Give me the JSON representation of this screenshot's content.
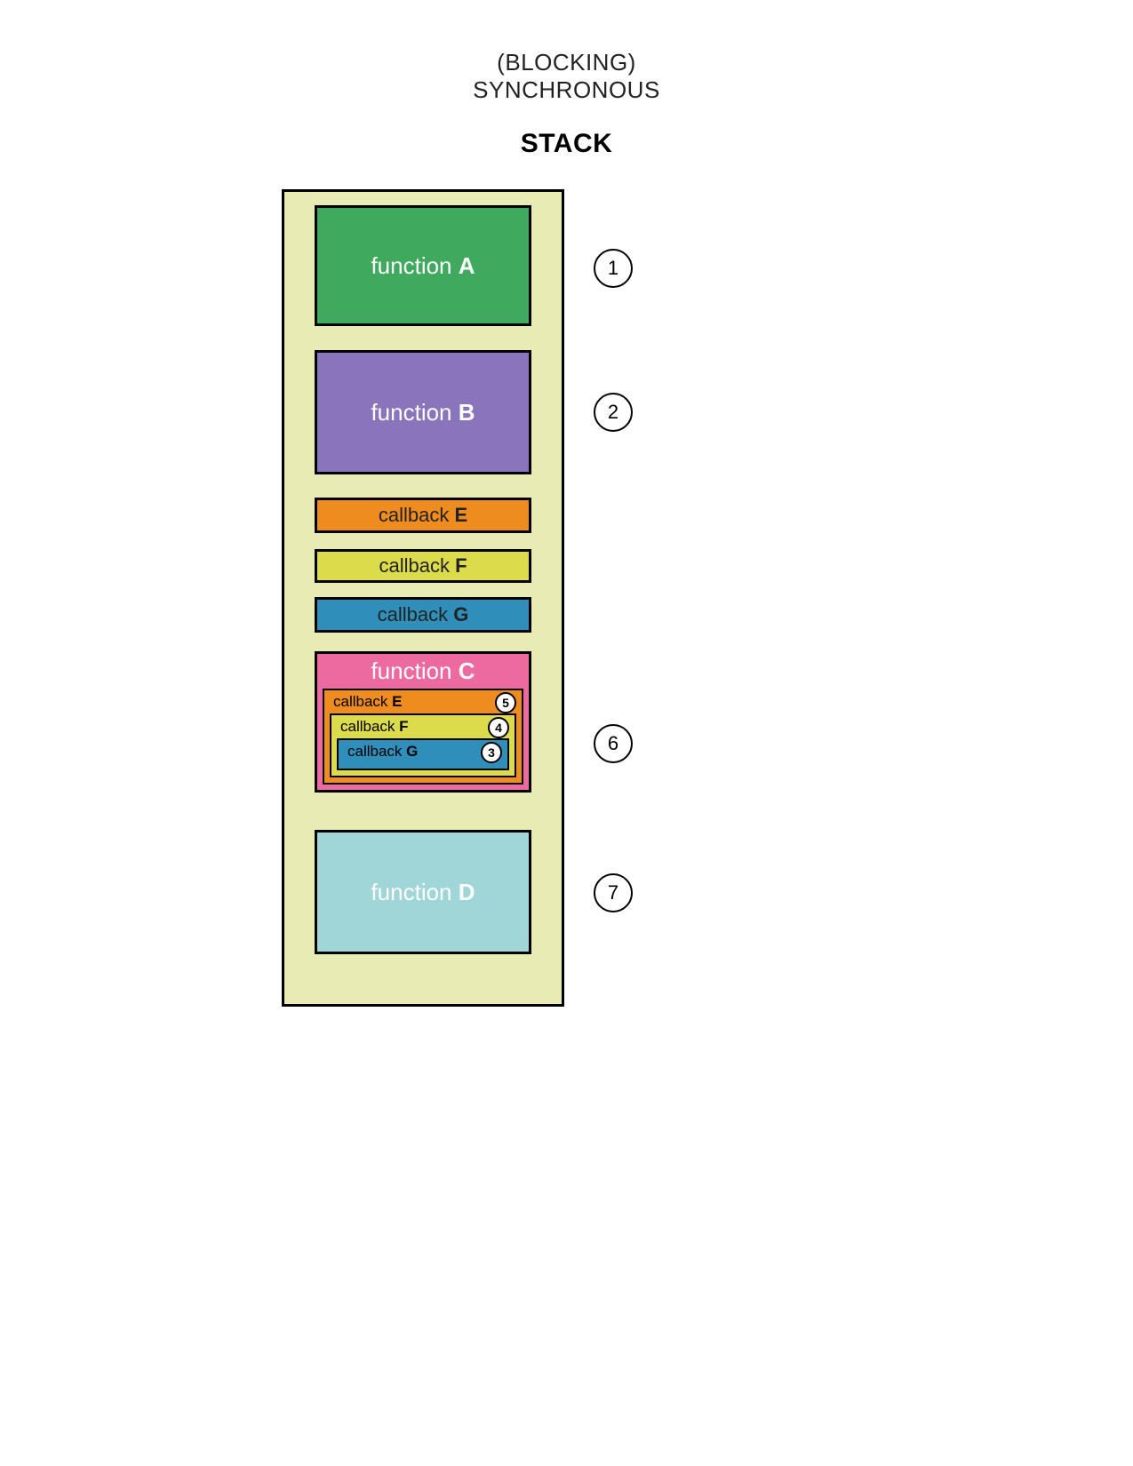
{
  "header": {
    "blocking": "(BLOCKING)",
    "synchronous": "SYNCHRONOUS",
    "stack": "STACK"
  },
  "colors": {
    "stack_bg": "#e8ecb4",
    "fn_a": "#3faa5d",
    "fn_b": "#8a74bb",
    "cb_e": "#ef8c1f",
    "cb_f": "#dbdb4b",
    "cb_g": "#2f8fba",
    "fn_c": "#ec6aa0",
    "fn_d": "#a0d6d8"
  },
  "boxes": {
    "functionA": {
      "prefix": "function ",
      "letter": "A"
    },
    "functionB": {
      "prefix": "function ",
      "letter": "B"
    },
    "callbackE": {
      "prefix": "callback ",
      "letter": "E"
    },
    "callbackF": {
      "prefix": "callback ",
      "letter": "F"
    },
    "callbackG": {
      "prefix": "callback ",
      "letter": "G"
    },
    "functionC": {
      "prefix": "function ",
      "letter": "C"
    },
    "nested_e": {
      "prefix": "callback ",
      "letter": "E"
    },
    "nested_f": {
      "prefix": "callback ",
      "letter": "F"
    },
    "nested_g": {
      "prefix": "callback ",
      "letter": "G"
    },
    "functionD": {
      "prefix": "function ",
      "letter": "D"
    }
  },
  "bubbles": {
    "b1": "1",
    "b2": "2",
    "b3": "3",
    "b4": "4",
    "b5": "5",
    "b6": "6",
    "b7": "7"
  }
}
